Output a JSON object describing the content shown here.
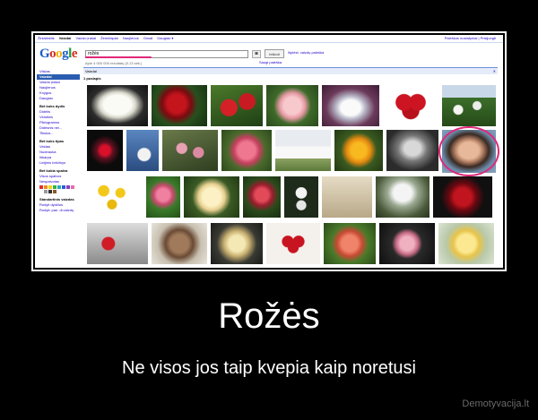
{
  "google": {
    "topbar_links": [
      "Žiniatinklis",
      "Vaizdai",
      "Vaizdo įrašai",
      "Žemėlapiai",
      "Naujienos",
      "Gmail",
      "Daugiau ▾"
    ],
    "topbar_right": "Paieškos nustatymai | Prisijungti",
    "logo_letters": [
      "G",
      "o",
      "o",
      "g",
      "l",
      "e"
    ],
    "search_value": "rožės",
    "search_button": "Ieškoti",
    "advanced_link": "Išplėst. vaizdų paieška",
    "safe_link": "Saugi paieška",
    "stats": "Apie 4 000 000 rezultatų (0,13 sek.)",
    "results_bar": "Vaizdai",
    "results_close": "✕",
    "page_label": "1 puslapis",
    "sidebar": {
      "items": [
        "Viskas",
        "Vaizdai",
        "Vaizdo įrašai",
        "Naujienos",
        "Knygos",
        "Daugiau"
      ],
      "size_head": "Bet koks dydis",
      "size_items": [
        "Didelis",
        "Vidutinis",
        "Piktogramos",
        "Didesnis nei...",
        "Tikslus..."
      ],
      "type_head": "Bet koks tipas",
      "type_items": [
        "Veidas",
        "Nuotrauka",
        "Iškarpa",
        "Linijinis brėžinys"
      ],
      "color_head": "Bet kokia spalva",
      "color_items": [
        "Visos spalvos",
        "Nespalvotas"
      ],
      "palette": [
        "#e03030",
        "#f08c1e",
        "#f2d21e",
        "#37b23c",
        "#2aa9c4",
        "#2d5fd0",
        "#8a3ec2",
        "#e46bb0",
        "#ffffff",
        "#999999",
        "#333333",
        "#8a5a2b"
      ],
      "bottom_head": "Standartinis vaizdas",
      "bottom_items": [
        "Rodyti dydžius",
        "Rodyti: pan. di.vaizdų"
      ]
    },
    "colors": {
      "link": "#2222cc",
      "active_bg": "#2a5db0",
      "highlight": "#e0287a"
    }
  },
  "caption": {
    "title": "Rožės",
    "subtitle": "Ne visos jos taip kvepia kaip noretusi",
    "watermark": "Demotyvacija.lt"
  }
}
